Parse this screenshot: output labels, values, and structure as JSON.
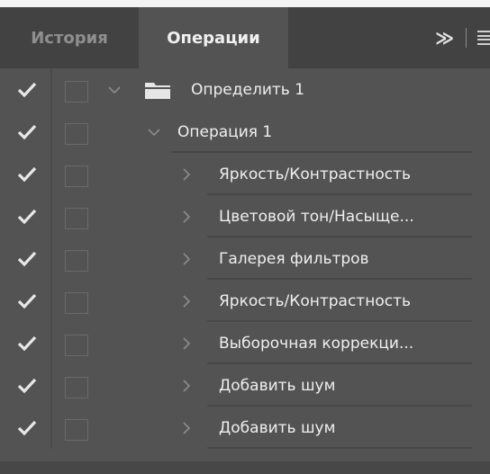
{
  "tabs": [
    {
      "label": "История",
      "active": false
    },
    {
      "label": "Операции",
      "active": true
    }
  ],
  "toolbar": {
    "expand_icon": "chevron-double-right-icon",
    "expand_glyph": "≫",
    "menu_icon": "hamburger-menu-icon"
  },
  "colors": {
    "panel_bg": "#535353",
    "tabbar_bg": "#424242",
    "text": "#efefef",
    "inactive_tab_text": "#8f8f8f"
  },
  "actions": {
    "set": {
      "label": "Определить 1",
      "expanded": true,
      "checked": true
    },
    "action": {
      "label": "Операция 1",
      "expanded": true,
      "checked": true
    },
    "steps": [
      {
        "label": "Яркость/Контрастность",
        "checked": true
      },
      {
        "label": "Цветовой тон/Насыще...",
        "checked": true
      },
      {
        "label": "Галерея фильтров",
        "checked": true
      },
      {
        "label": "Яркость/Контрастность",
        "checked": true
      },
      {
        "label": "Выборочная коррекци...",
        "checked": true
      },
      {
        "label": "Добавить шум",
        "checked": true
      },
      {
        "label": "Добавить шум",
        "checked": true
      }
    ]
  }
}
